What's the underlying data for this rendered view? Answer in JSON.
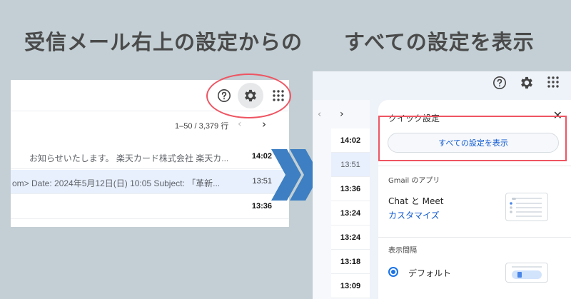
{
  "headlines": {
    "left": "受信メール右上の設定からの",
    "right": "すべての設定を表示"
  },
  "left_panel": {
    "pager": "1–50 / 3,379 行",
    "rows": [
      {
        "snippet": "お知らせいたします。 楽天カード株式会社 楽天カ...",
        "time": "14:02",
        "unread": true,
        "selected": false
      },
      {
        "snippet": "om> Date: 2024年5月12日(日) 10:05 Subject: 「革新...",
        "time": "13:51",
        "unread": false,
        "selected": true
      },
      {
        "snippet": "",
        "time": "13:36",
        "unread": true,
        "selected": false
      }
    ]
  },
  "right_panel": {
    "times": [
      {
        "value": "14:02",
        "bold": true
      },
      {
        "value": "13:51",
        "bold": false
      },
      {
        "value": "13:36",
        "bold": true
      },
      {
        "value": "13:24",
        "bold": true
      },
      {
        "value": "13:24",
        "bold": true
      },
      {
        "value": "13:18",
        "bold": true
      },
      {
        "value": "13:09",
        "bold": true
      }
    ],
    "quick_settings": {
      "title": "クイック設定",
      "close_glyph": "✕",
      "all_settings_button": "すべての設定を表示",
      "apps_section": "Gmail のアプリ",
      "app_name": "Chat と Meet",
      "customize_link": "カスタマイズ",
      "density_section": "表示間隔",
      "default_option": "デフォルト"
    }
  },
  "colors": {
    "background": "#c3cfd4",
    "highlight_red": "#ee5562",
    "arrow_blue": "#3d7fc2",
    "link_blue": "#0b57d0"
  },
  "icons": [
    "help-icon",
    "gear-icon",
    "apps-grid-icon",
    "chevron-left-icon",
    "chevron-right-icon",
    "close-icon",
    "double-chevron-arrow-icon"
  ]
}
